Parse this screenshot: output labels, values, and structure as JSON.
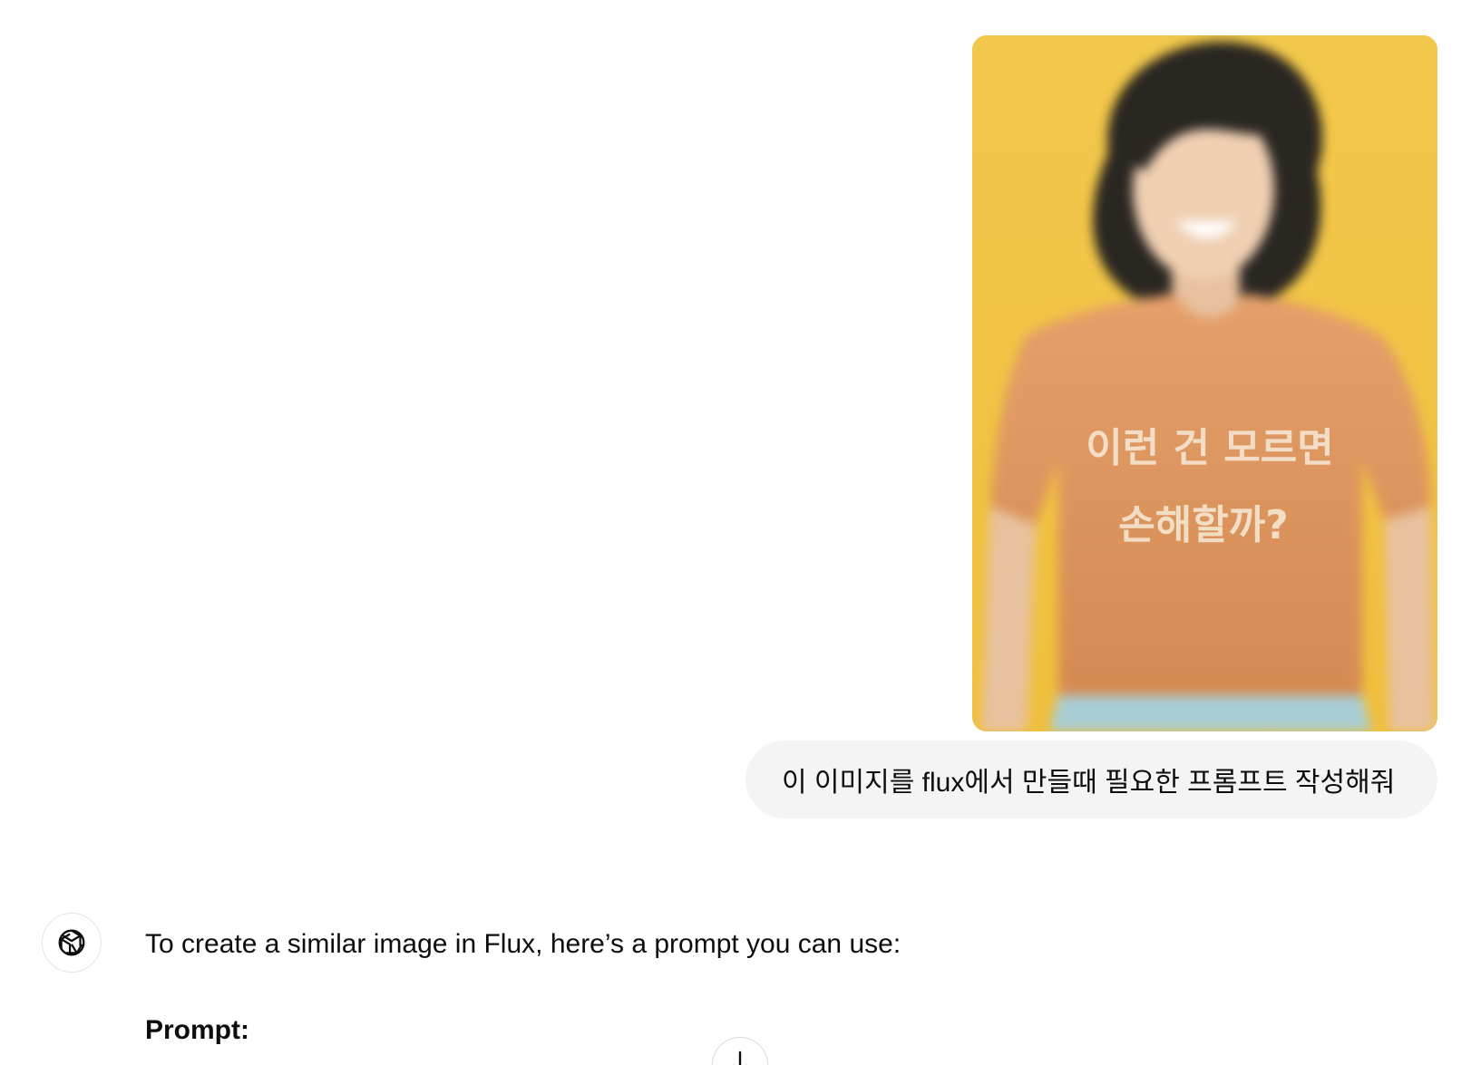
{
  "user_message": {
    "image": {
      "alt_icon": "photo-attachment",
      "shirt_lettering_line1": "이런 건 모르면",
      "shirt_lettering_line2": "손해할까?"
    },
    "text": "이 이미지를 flux에서 만들때 필요한 프롬프트 작성해줘"
  },
  "assistant_message": {
    "avatar_icon": "openai-logo-icon",
    "intro": "To create a similar image in Flux, here’s a prompt you can use:",
    "prompt_heading": "Prompt:"
  },
  "scroll_button": {
    "icon": "arrow-down-icon"
  },
  "colors": {
    "bubble_bg": "#f4f4f4",
    "image_bg": "#f3c94e",
    "shirt": "#d9925a",
    "text": "#0d0d0d"
  }
}
